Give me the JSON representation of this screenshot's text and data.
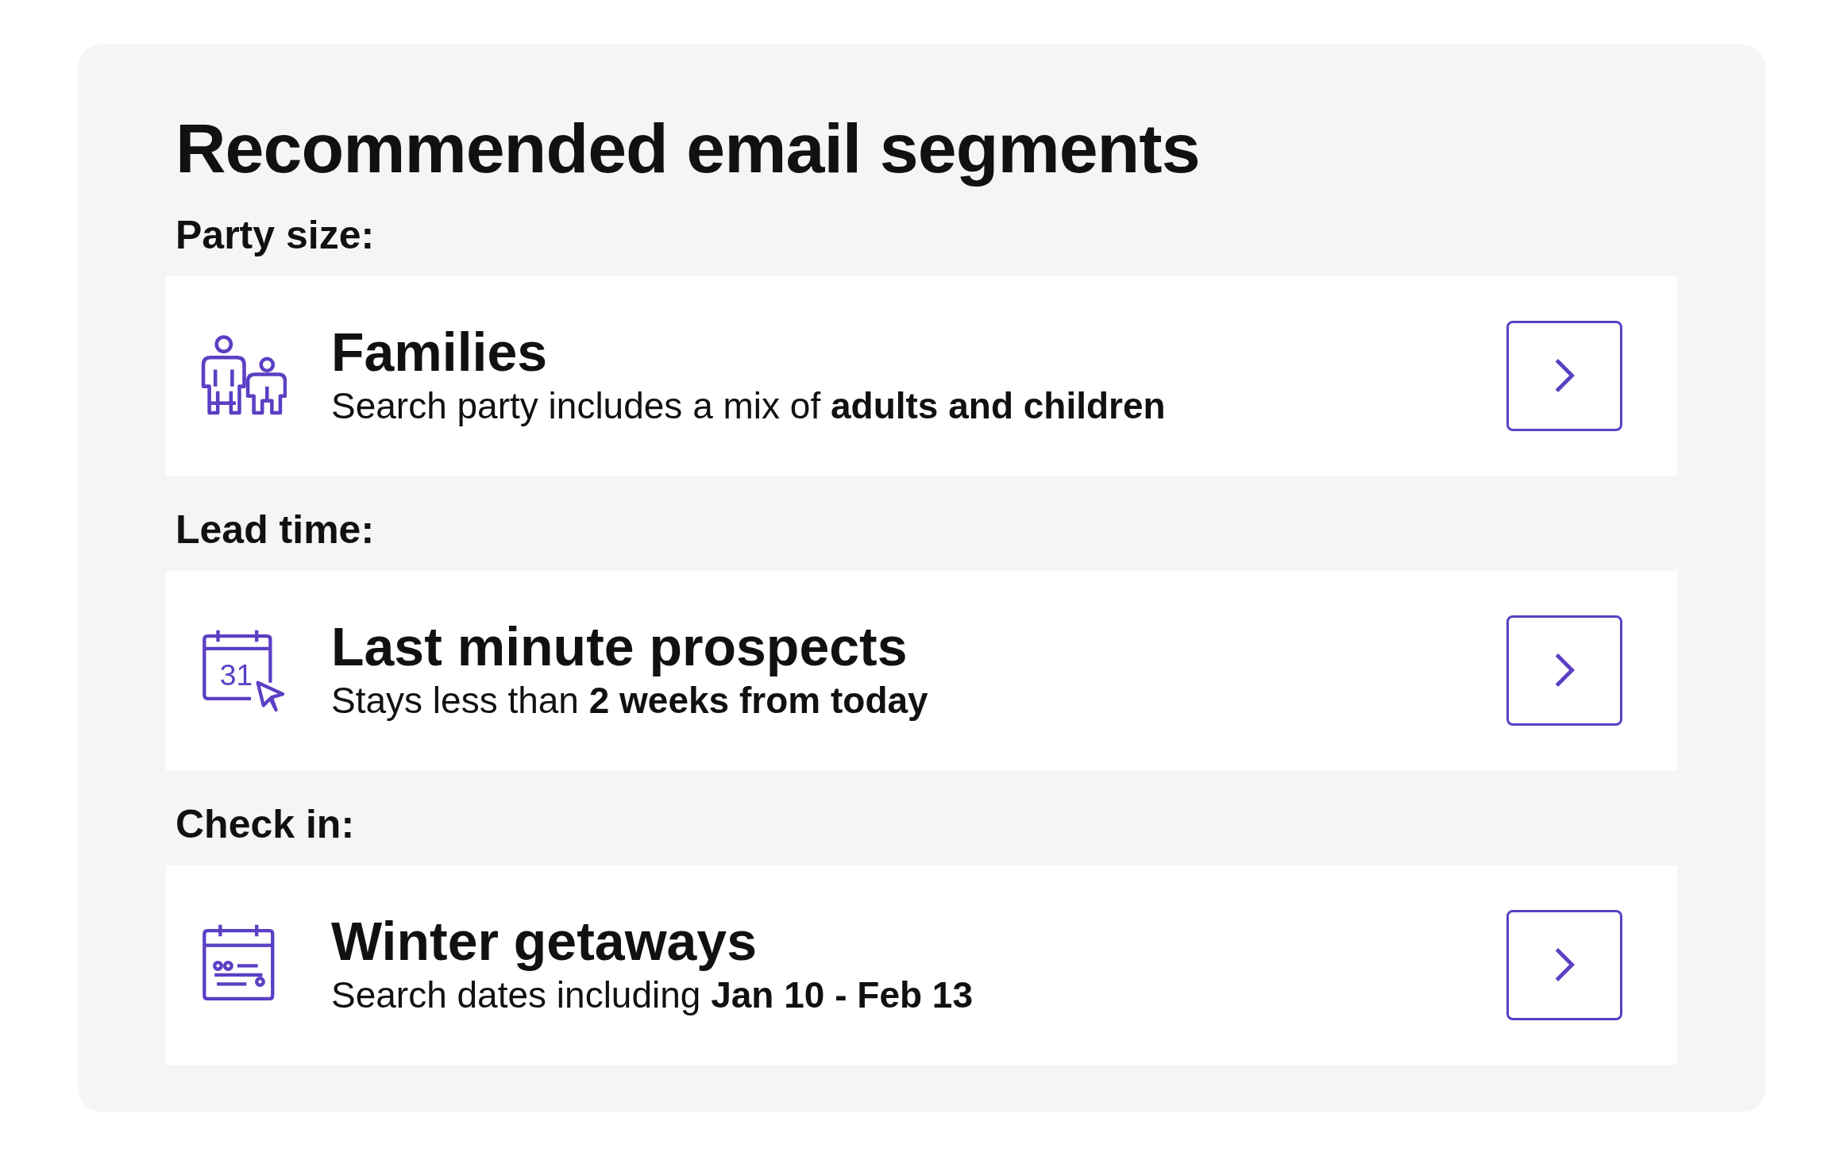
{
  "title": "Recommended email segments",
  "sections": [
    {
      "label": "Party size:",
      "segment": {
        "kind": "family",
        "title": "Families",
        "description": "Search party includes a mix of **adults and children**"
      }
    },
    {
      "label": "Lead time:",
      "segment": {
        "kind": "calendar-day",
        "day": "31",
        "title": "Last minute prospects",
        "description": "Stays less than **2 weeks from today**"
      }
    },
    {
      "label": "Check in:",
      "segment": {
        "kind": "calendar-range",
        "title": "Winter getaways",
        "description": "Search dates including **Jan 10 - Feb 13**"
      }
    }
  ]
}
